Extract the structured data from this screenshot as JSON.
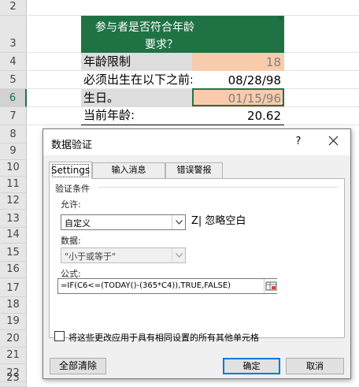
{
  "sheet": {
    "rows": [
      "2",
      "3",
      "4",
      "5",
      "6",
      "7",
      "8",
      "9",
      "10",
      "11",
      "12",
      "13",
      "14",
      "15",
      "16",
      "17",
      "18",
      "19",
      "20",
      "21",
      "22",
      "23"
    ],
    "title_line1": "参与者是否符合年龄",
    "title_line2": "要求？",
    "age_limit_label": "年龄限制",
    "age_limit_value": "18",
    "born_before_label": "必须出生在以下之前:",
    "born_before_value": "08/28/98",
    "birthday_label": "生日。",
    "birthday_value": "01/15/96",
    "current_age_label": "当前年龄:",
    "current_age_value": "20.62"
  },
  "dialog": {
    "title": "数据验证",
    "help": "?",
    "tabs": [
      "Settings",
      "输入消息",
      "错误警报"
    ],
    "section_label": "验证条件",
    "allow_label": "允许:",
    "allow_value": "自定义",
    "ignore_blank": "Z| 忽略空白",
    "data_label": "数据:",
    "data_value": "\"小于或等于\"",
    "formula_label": "公式:",
    "formula_value": "=IF(C6<=(TODAY()-(365*C4)),TRUE,FALSE)",
    "apply_all": "将这些更改应用于具有相同设置的所有其他单元格",
    "clear_all": "全部清除",
    "ok": "确定",
    "cancel": "取消"
  },
  "colors": {
    "title_fill": "#1f7244",
    "input_fill": "#f8cbad",
    "excel_green": "#217346"
  }
}
